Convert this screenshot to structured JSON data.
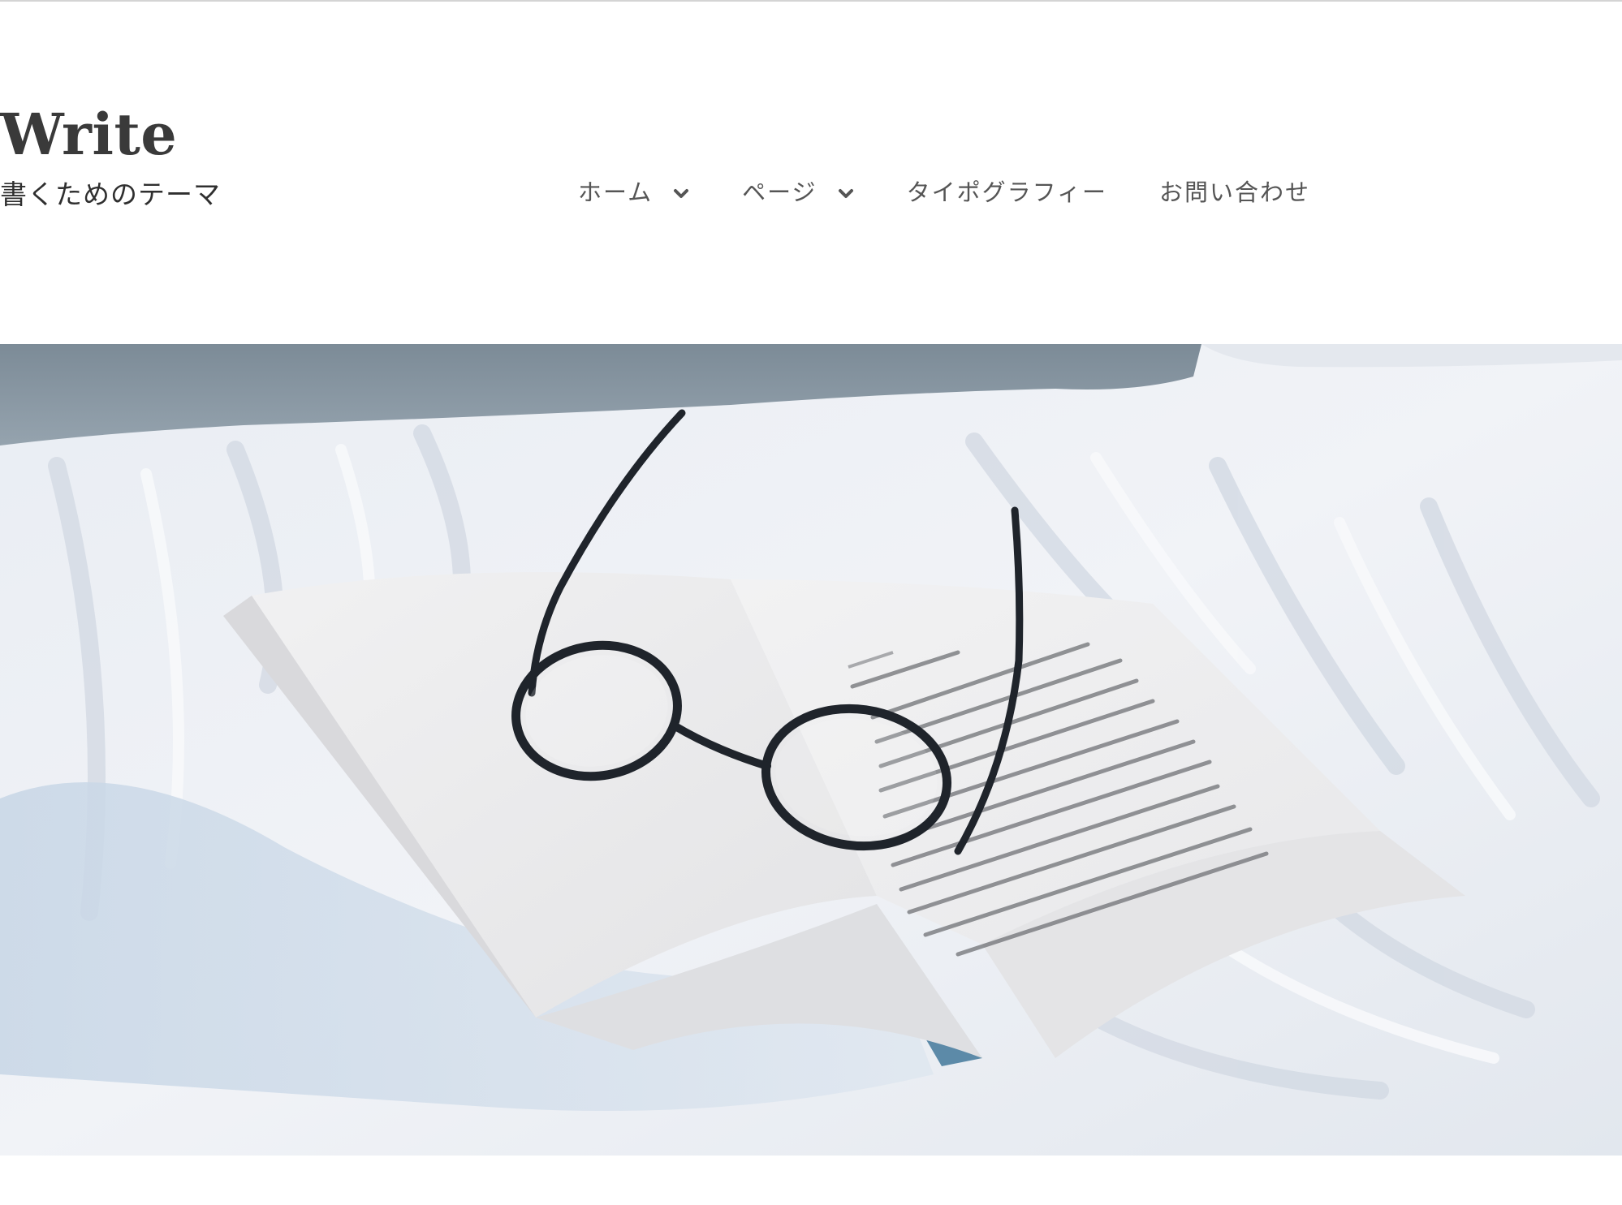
{
  "site": {
    "title": "Write",
    "tagline": "書くためのテーマ"
  },
  "nav": {
    "items": [
      {
        "label": "ホーム",
        "has_submenu": true,
        "icon": "chevron-down-icon"
      },
      {
        "label": "ページ",
        "has_submenu": true,
        "icon": "chevron-down-icon"
      },
      {
        "label": "タイポグラフィー",
        "has_submenu": false
      },
      {
        "label": "お問い合わせ",
        "has_submenu": false
      }
    ]
  },
  "hero": {
    "image": "open-book-with-glasses-on-bed"
  },
  "colors": {
    "title": "#3a3a3a",
    "nav_text": "#555555",
    "background": "#ffffff"
  }
}
